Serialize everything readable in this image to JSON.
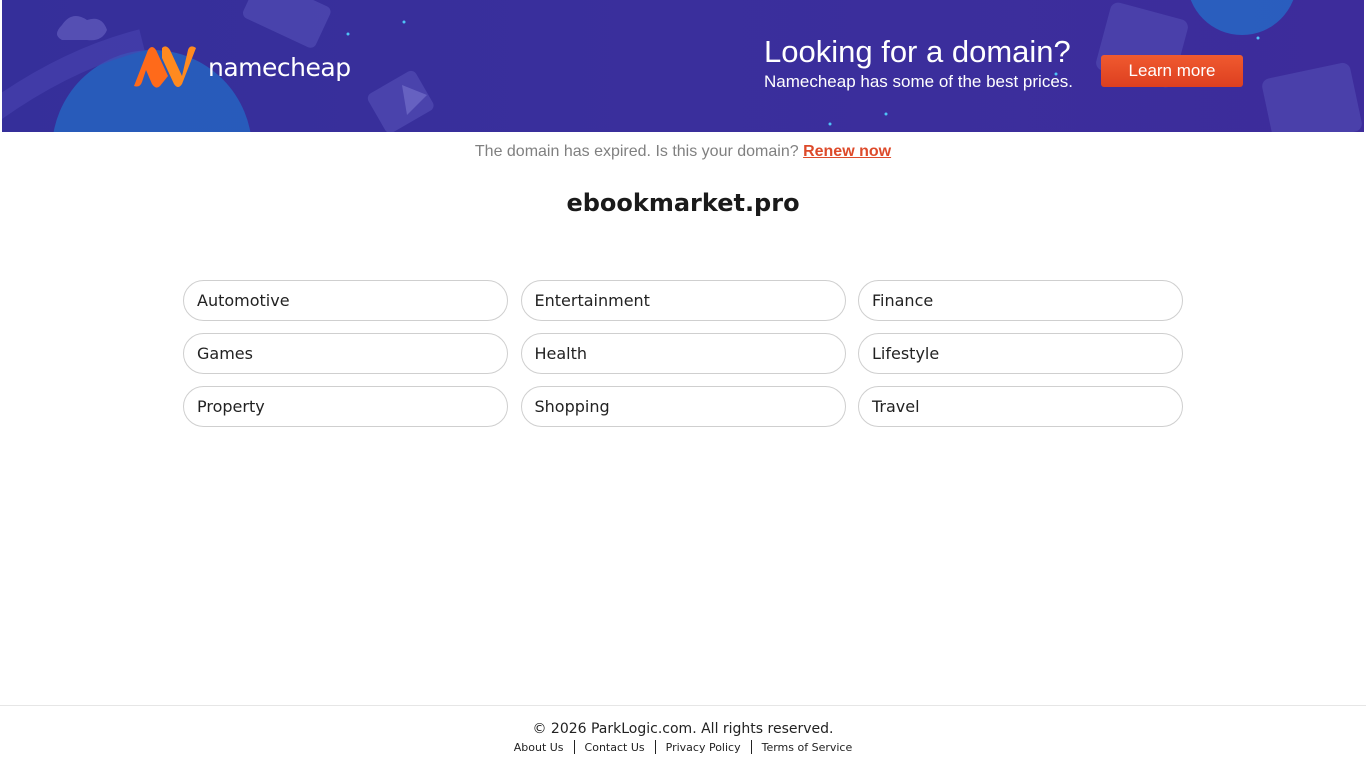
{
  "banner": {
    "brand": "namecheap",
    "headline": "Looking for a domain?",
    "subline": "Namecheap has some of the best prices.",
    "cta_label": "Learn more",
    "colors": {
      "background": "#3a2f9c",
      "accent": "#f05a2f",
      "logo": "#ff6a1a"
    }
  },
  "notice": {
    "text": "The domain has expired. Is this your domain?",
    "link_label": "Renew now"
  },
  "domain": "ebookmarket.pro",
  "categories": [
    "Automotive",
    "Entertainment",
    "Finance",
    "Games",
    "Health",
    "Lifestyle",
    "Property",
    "Shopping",
    "Travel"
  ],
  "footer": {
    "copyright": "© 2026 ParkLogic.com. All rights reserved.",
    "links": [
      "About Us",
      "Contact Us",
      "Privacy Policy",
      "Terms of Service"
    ]
  }
}
